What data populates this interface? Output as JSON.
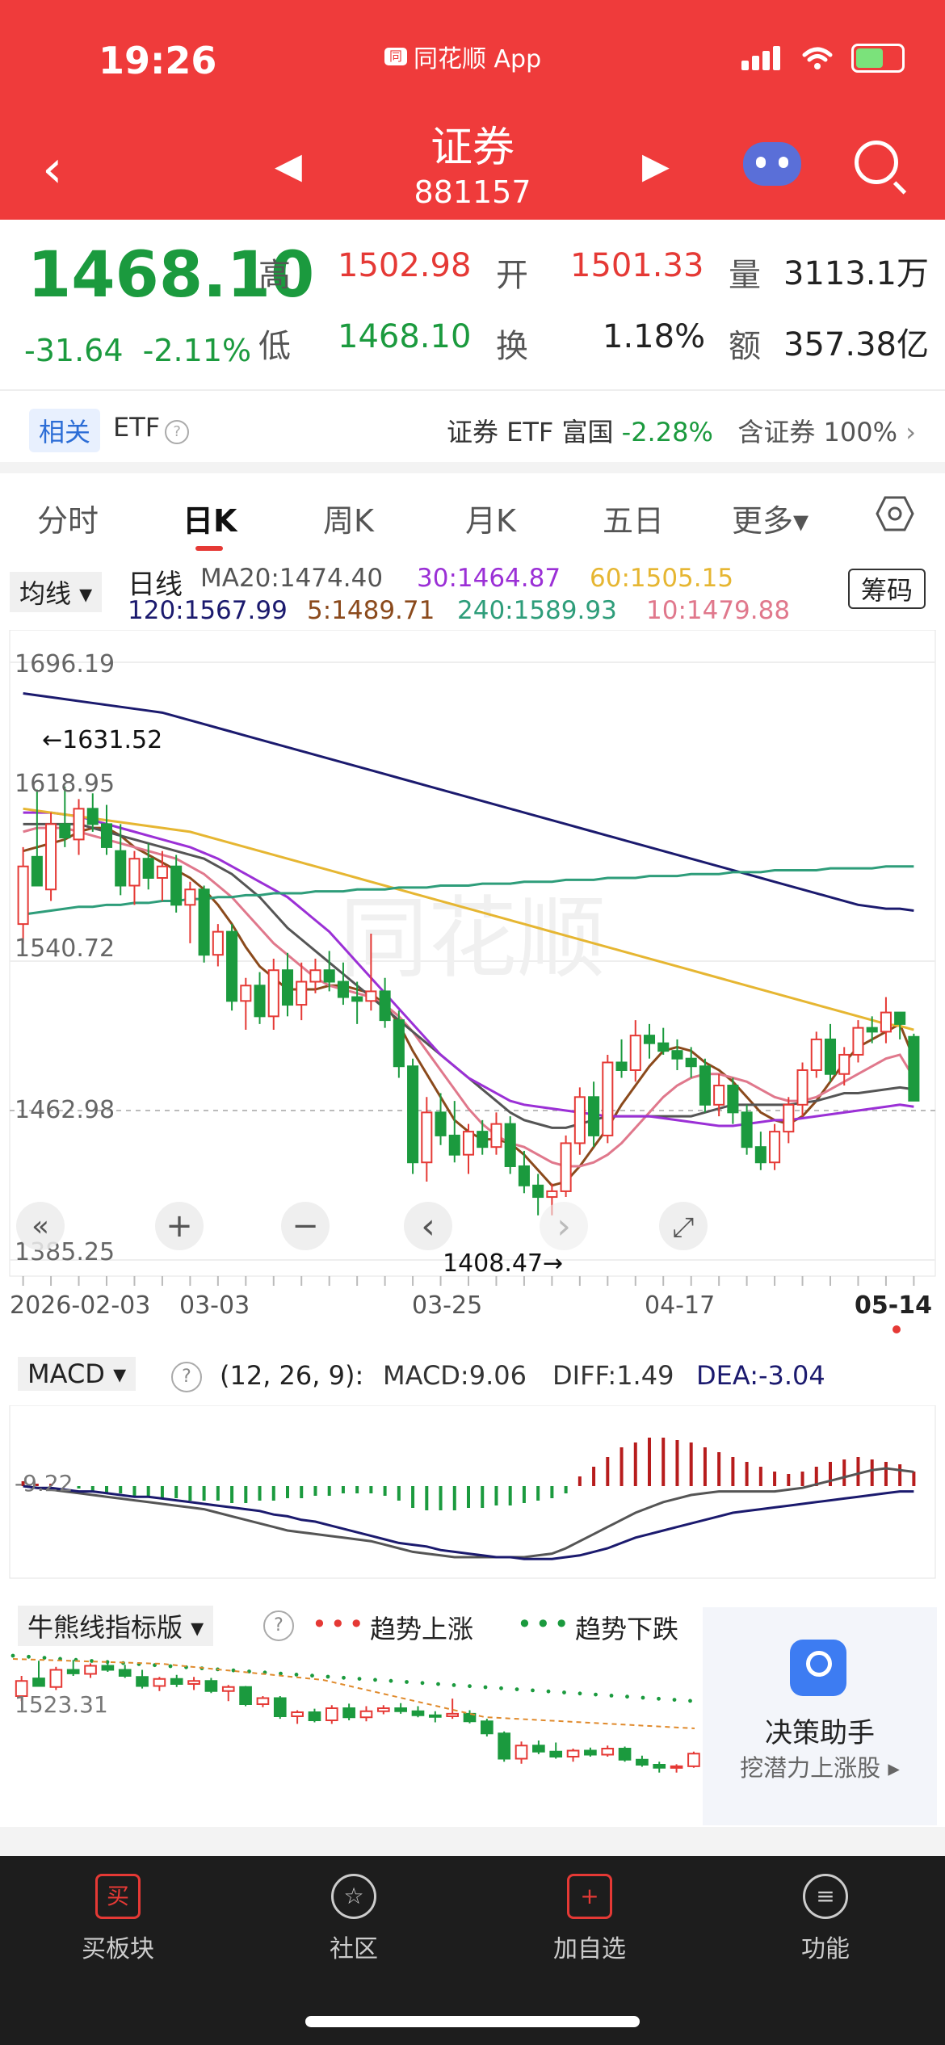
{
  "status_bar": {
    "time": "19:26",
    "app_name": "同花顺 App",
    "app_logo_text": "同"
  },
  "header": {
    "title": "证券",
    "code": "881157",
    "back_icon": "‹",
    "prev_icon": "◀",
    "next_icon": "▶"
  },
  "quote": {
    "price": "1468.10",
    "change": "-31.64",
    "change_pct": "-2.11%",
    "high_label": "高",
    "high": "1502.98",
    "open_label": "开",
    "open": "1501.33",
    "volume_label": "量",
    "volume": "3113.1万",
    "low_label": "低",
    "low": "1468.10",
    "turnover_label": "换",
    "turnover": "1.18%",
    "amount_label": "额",
    "amount": "357.38亿"
  },
  "related": {
    "tag": "相关",
    "etf": "ETF",
    "etf_name": "证券 ETF 富国",
    "etf_change": "-2.28%",
    "holding_label": "含证券",
    "holding": "100%",
    "chevron": "›",
    "help": "?"
  },
  "tabs": [
    "分时",
    "日K",
    "周K",
    "月K",
    "五日",
    "更多▾"
  ],
  "active_tab": "日K",
  "ma_legend": {
    "selector": "均线 ▾",
    "period": "日线",
    "chip": "筹码",
    "ma20": "MA20:1474.40",
    "ma30": "30:1464.87",
    "ma60": "60:1505.15",
    "ma120": "120:1567.99",
    "ma5": "5:1489.71",
    "ma240": "240:1589.93",
    "ma10": "10:1479.88",
    "colors": {
      "ma20": "#555555",
      "ma30": "#9b30d6",
      "ma60": "#e6b632",
      "ma120": "#1b1a6e",
      "ma5": "#8b4a1c",
      "ma240": "#2e9d7a",
      "ma10": "#e0788c"
    }
  },
  "kchart": {
    "y_labels": [
      "1696.19",
      "1540.72",
      "1462.98",
      "1385.25"
    ],
    "overlay_label": "1618.95",
    "high_marker": "←1631.52",
    "low_marker": "1408.47→",
    "x_labels": [
      "2026-02-03",
      "03-03",
      "03-25",
      "04-17",
      "05-14"
    ],
    "controls": [
      "«",
      "+",
      "−",
      "‹",
      "›",
      "⤢"
    ],
    "watermark": "同花顺"
  },
  "chart_data": {
    "type": "candlestick",
    "title": "证券 881157 日K",
    "ylim": [
      1385.25,
      1696.19
    ],
    "reference_line": 1462.98,
    "candles": [
      [
        1560,
        1600,
        1550,
        1590
      ],
      [
        1595,
        1630,
        1588,
        1580
      ],
      [
        1578,
        1618,
        1572,
        1612
      ],
      [
        1612,
        1631.52,
        1600,
        1605
      ],
      [
        1604,
        1625,
        1596,
        1620
      ],
      [
        1620,
        1628,
        1608,
        1612
      ],
      [
        1612,
        1622,
        1596,
        1600
      ],
      [
        1598,
        1612,
        1575,
        1580
      ],
      [
        1580,
        1598,
        1570,
        1594
      ],
      [
        1594,
        1602,
        1578,
        1584
      ],
      [
        1584,
        1598,
        1572,
        1590
      ],
      [
        1590,
        1596,
        1566,
        1570
      ],
      [
        1570,
        1582,
        1550,
        1578
      ],
      [
        1578,
        1580,
        1540,
        1544
      ],
      [
        1544,
        1560,
        1538,
        1556
      ],
      [
        1556,
        1560,
        1515,
        1520
      ],
      [
        1520,
        1532,
        1505,
        1528
      ],
      [
        1528,
        1535,
        1508,
        1512
      ],
      [
        1512,
        1542,
        1505,
        1536
      ],
      [
        1536,
        1545,
        1512,
        1518
      ],
      [
        1518,
        1540,
        1510,
        1530
      ],
      [
        1530,
        1542,
        1524,
        1536
      ],
      [
        1536,
        1546,
        1525,
        1530
      ],
      [
        1530,
        1540,
        1518,
        1522
      ],
      [
        1522,
        1530,
        1508,
        1520
      ],
      [
        1520,
        1555,
        1515,
        1525
      ],
      [
        1525,
        1532,
        1506,
        1510
      ],
      [
        1510,
        1515,
        1480,
        1486
      ],
      [
        1486,
        1490,
        1430,
        1436
      ],
      [
        1436,
        1470,
        1426,
        1462
      ],
      [
        1462,
        1472,
        1445,
        1450
      ],
      [
        1450,
        1468,
        1436,
        1440
      ],
      [
        1440,
        1456,
        1430,
        1452
      ],
      [
        1452,
        1458,
        1440,
        1444
      ],
      [
        1444,
        1462,
        1440,
        1456
      ],
      [
        1456,
        1460,
        1430,
        1434
      ],
      [
        1434,
        1442,
        1420,
        1424
      ],
      [
        1424,
        1430,
        1408.47,
        1418
      ],
      [
        1418,
        1425,
        1408.47,
        1421
      ],
      [
        1421,
        1450,
        1418,
        1446
      ],
      [
        1446,
        1475,
        1440,
        1470
      ],
      [
        1470,
        1478,
        1444,
        1450
      ],
      [
        1450,
        1492,
        1446,
        1488
      ],
      [
        1488,
        1500,
        1480,
        1484
      ],
      [
        1484,
        1510,
        1478,
        1502
      ],
      [
        1502,
        1508,
        1490,
        1498
      ],
      [
        1498,
        1506,
        1492,
        1494
      ],
      [
        1494,
        1500,
        1484,
        1490
      ],
      [
        1490,
        1496,
        1480,
        1486
      ],
      [
        1486,
        1490,
        1462,
        1466
      ],
      [
        1466,
        1482,
        1460,
        1476
      ],
      [
        1476,
        1480,
        1456,
        1462
      ],
      [
        1462,
        1466,
        1440,
        1444
      ],
      [
        1444,
        1452,
        1432,
        1436
      ],
      [
        1436,
        1456,
        1432,
        1452
      ],
      [
        1452,
        1470,
        1446,
        1466
      ],
      [
        1466,
        1488,
        1460,
        1484
      ],
      [
        1484,
        1504,
        1480,
        1500
      ],
      [
        1500,
        1508,
        1478,
        1482
      ],
      [
        1482,
        1496,
        1476,
        1492
      ],
      [
        1492,
        1510,
        1488,
        1506
      ],
      [
        1506,
        1512,
        1498,
        1504
      ],
      [
        1504,
        1522,
        1498,
        1514
      ],
      [
        1514,
        1512,
        1500,
        1508
      ],
      [
        1501.33,
        1502.98,
        1468.1,
        1468.1
      ]
    ],
    "ma_lines": {
      "ma5": [
        1598,
        1600,
        1602,
        1604,
        1608,
        1610,
        1610,
        1606,
        1600,
        1596,
        1592,
        1588,
        1584,
        1578,
        1570,
        1560,
        1548,
        1538,
        1532,
        1526,
        1526,
        1526,
        1528,
        1528,
        1526,
        1524,
        1518,
        1508,
        1494,
        1482,
        1470,
        1458,
        1452,
        1448,
        1448,
        1446,
        1440,
        1432,
        1424,
        1426,
        1434,
        1444,
        1454,
        1466,
        1476,
        1486,
        1494,
        1496,
        1494,
        1488,
        1484,
        1478,
        1470,
        1462,
        1458,
        1456,
        1460,
        1468,
        1478,
        1488,
        1496,
        1500,
        1504,
        1508,
        1490
      ],
      "ma10": [
        1608,
        1610,
        1610,
        1610,
        1608,
        1606,
        1604,
        1602,
        1600,
        1598,
        1596,
        1594,
        1590,
        1586,
        1580,
        1574,
        1566,
        1558,
        1550,
        1544,
        1538,
        1532,
        1528,
        1526,
        1524,
        1522,
        1518,
        1512,
        1504,
        1494,
        1484,
        1474,
        1464,
        1456,
        1450,
        1446,
        1444,
        1440,
        1436,
        1434,
        1434,
        1436,
        1440,
        1446,
        1454,
        1462,
        1470,
        1476,
        1480,
        1482,
        1482,
        1480,
        1478,
        1474,
        1470,
        1468,
        1468,
        1470,
        1474,
        1478,
        1482,
        1486,
        1490,
        1492,
        1480
      ],
      "ma20": [
        1612,
        1612,
        1612,
        1612,
        1612,
        1610,
        1608,
        1606,
        1604,
        1602,
        1600,
        1598,
        1596,
        1594,
        1590,
        1586,
        1580,
        1574,
        1566,
        1558,
        1552,
        1546,
        1540,
        1534,
        1528,
        1522,
        1516,
        1510,
        1504,
        1498,
        1492,
        1486,
        1480,
        1474,
        1468,
        1462,
        1458,
        1456,
        1454,
        1454,
        1456,
        1458,
        1460,
        1460,
        1460,
        1460,
        1460,
        1460,
        1460,
        1462,
        1464,
        1466,
        1466,
        1466,
        1466,
        1466,
        1467,
        1468,
        1470,
        1472,
        1472,
        1473,
        1474,
        1475,
        1474
      ],
      "ma30": [
        1618,
        1618,
        1618,
        1617,
        1616,
        1614,
        1612,
        1610,
        1608,
        1606,
        1604,
        1602,
        1600,
        1597,
        1594,
        1590,
        1586,
        1582,
        1578,
        1574,
        1568,
        1562,
        1556,
        1548,
        1540,
        1532,
        1524,
        1516,
        1508,
        1500,
        1492,
        1486,
        1480,
        1476,
        1472,
        1468,
        1466,
        1465,
        1464,
        1463,
        1462,
        1461,
        1460,
        1460,
        1460,
        1460,
        1459,
        1458,
        1457,
        1456,
        1455,
        1455,
        1456,
        1457,
        1458,
        1458,
        1459,
        1460,
        1461,
        1462,
        1463,
        1464,
        1465,
        1466,
        1465
      ],
      "ma60": [
        1620,
        1619,
        1618,
        1617,
        1616,
        1615,
        1614,
        1613,
        1612,
        1611,
        1610,
        1609,
        1608,
        1606,
        1604,
        1602,
        1600,
        1598,
        1596,
        1594,
        1592,
        1590,
        1588,
        1586,
        1584,
        1582,
        1580,
        1578,
        1576,
        1574,
        1572,
        1570,
        1568,
        1566,
        1564,
        1562,
        1560,
        1558,
        1556,
        1554,
        1552,
        1550,
        1548,
        1546,
        1544,
        1542,
        1540,
        1538,
        1536,
        1534,
        1532,
        1530,
        1528,
        1526,
        1524,
        1522,
        1520,
        1518,
        1516,
        1514,
        1512,
        1510,
        1508,
        1507,
        1505
      ],
      "ma120": [
        1680,
        1679,
        1678,
        1677,
        1676,
        1675,
        1674,
        1673,
        1672,
        1671,
        1670,
        1668,
        1666,
        1664,
        1662,
        1660,
        1658,
        1656,
        1654,
        1652,
        1650,
        1648,
        1646,
        1644,
        1642,
        1640,
        1638,
        1636,
        1634,
        1632,
        1630,
        1628,
        1626,
        1624,
        1622,
        1620,
        1618,
        1616,
        1614,
        1612,
        1610,
        1608,
        1606,
        1604,
        1602,
        1600,
        1598,
        1596,
        1594,
        1592,
        1590,
        1588,
        1586,
        1584,
        1582,
        1580,
        1578,
        1576,
        1574,
        1572,
        1570,
        1569,
        1568,
        1568,
        1567
      ],
      "ma240": [
        1565,
        1566,
        1567,
        1568,
        1569,
        1569,
        1570,
        1570,
        1571,
        1571,
        1572,
        1572,
        1573,
        1573,
        1574,
        1574,
        1575,
        1575,
        1576,
        1576,
        1576,
        1577,
        1577,
        1577,
        1578,
        1578,
        1578,
        1579,
        1579,
        1579,
        1580,
        1580,
        1580,
        1581,
        1581,
        1581,
        1582,
        1582,
        1582,
        1583,
        1583,
        1583,
        1584,
        1584,
        1584,
        1585,
        1585,
        1585,
        1586,
        1586,
        1586,
        1587,
        1587,
        1587,
        1588,
        1588,
        1588,
        1588,
        1589,
        1589,
        1589,
        1589,
        1590,
        1590,
        1590
      ]
    }
  },
  "macd": {
    "selector": "MACD ▾",
    "help": "?",
    "params": "(12, 26, 9):",
    "macd": "MACD:9.06",
    "diff": "DIFF:1.49",
    "dea": "DEA:-3.04",
    "axis_label": "-9.22",
    "hist": [
      2,
      1,
      1,
      0,
      -1,
      -2,
      -3,
      -3,
      -4,
      -4,
      -5,
      -5,
      -6,
      -6,
      -6,
      -7,
      -7,
      -6,
      -6,
      -5,
      -5,
      -4,
      -4,
      -3,
      -3,
      -3,
      -4,
      -6,
      -9,
      -10,
      -10,
      -10,
      -9,
      -9,
      -8,
      -8,
      -7,
      -6,
      -5,
      -3,
      4,
      8,
      12,
      16,
      18,
      20,
      20,
      19,
      18,
      16,
      14,
      12,
      10,
      8,
      6,
      5,
      6,
      8,
      10,
      11,
      12,
      11,
      10,
      9,
      6
    ],
    "diff_line": [
      0,
      -1,
      -2,
      -3,
      -4,
      -5,
      -6,
      -7,
      -8,
      -9,
      -10,
      -11,
      -12,
      -13,
      -15,
      -17,
      -19,
      -21,
      -23,
      -25,
      -26,
      -27,
      -28,
      -29,
      -30,
      -31,
      -33,
      -35,
      -37,
      -38,
      -39,
      -40,
      -40,
      -40,
      -40,
      -40,
      -40,
      -39,
      -38,
      -35,
      -31,
      -27,
      -23,
      -19,
      -15,
      -12,
      -9,
      -7,
      -5,
      -4,
      -3,
      -3,
      -3,
      -3,
      -3,
      -2,
      -1,
      1,
      3,
      5,
      7,
      9,
      10,
      9,
      8
    ],
    "dea_line": [
      0,
      -1,
      -1,
      -2,
      -3,
      -3,
      -4,
      -5,
      -6,
      -6,
      -7,
      -8,
      -9,
      -10,
      -11,
      -12,
      -13,
      -14,
      -16,
      -17,
      -19,
      -20,
      -22,
      -24,
      -26,
      -28,
      -30,
      -32,
      -33,
      -34,
      -36,
      -37,
      -38,
      -39,
      -40,
      -40,
      -41,
      -41,
      -41,
      -40,
      -39,
      -37,
      -35,
      -32,
      -29,
      -27,
      -25,
      -23,
      -21,
      -19,
      -17,
      -15,
      -14,
      -13,
      -12,
      -11,
      -10,
      -9,
      -8,
      -7,
      -6,
      -5,
      -4,
      -3,
      -3
    ]
  },
  "bull_bear": {
    "selector": "牛熊线指标版 ▾",
    "help": "?",
    "up_label": "趋势上涨",
    "down_label": "趋势下跌",
    "up_color": "#e53935",
    "down_color": "#1b9a3e",
    "axis_label": "1523.31"
  },
  "assistant": {
    "title": "决策助手",
    "subtitle": "挖潜力上涨股 ▸"
  },
  "nav": [
    {
      "icon": "买",
      "label": "买板块"
    },
    {
      "icon": "☆",
      "label": "社区"
    },
    {
      "icon": "+",
      "label": "加自选"
    },
    {
      "icon": "≡",
      "label": "功能"
    }
  ]
}
